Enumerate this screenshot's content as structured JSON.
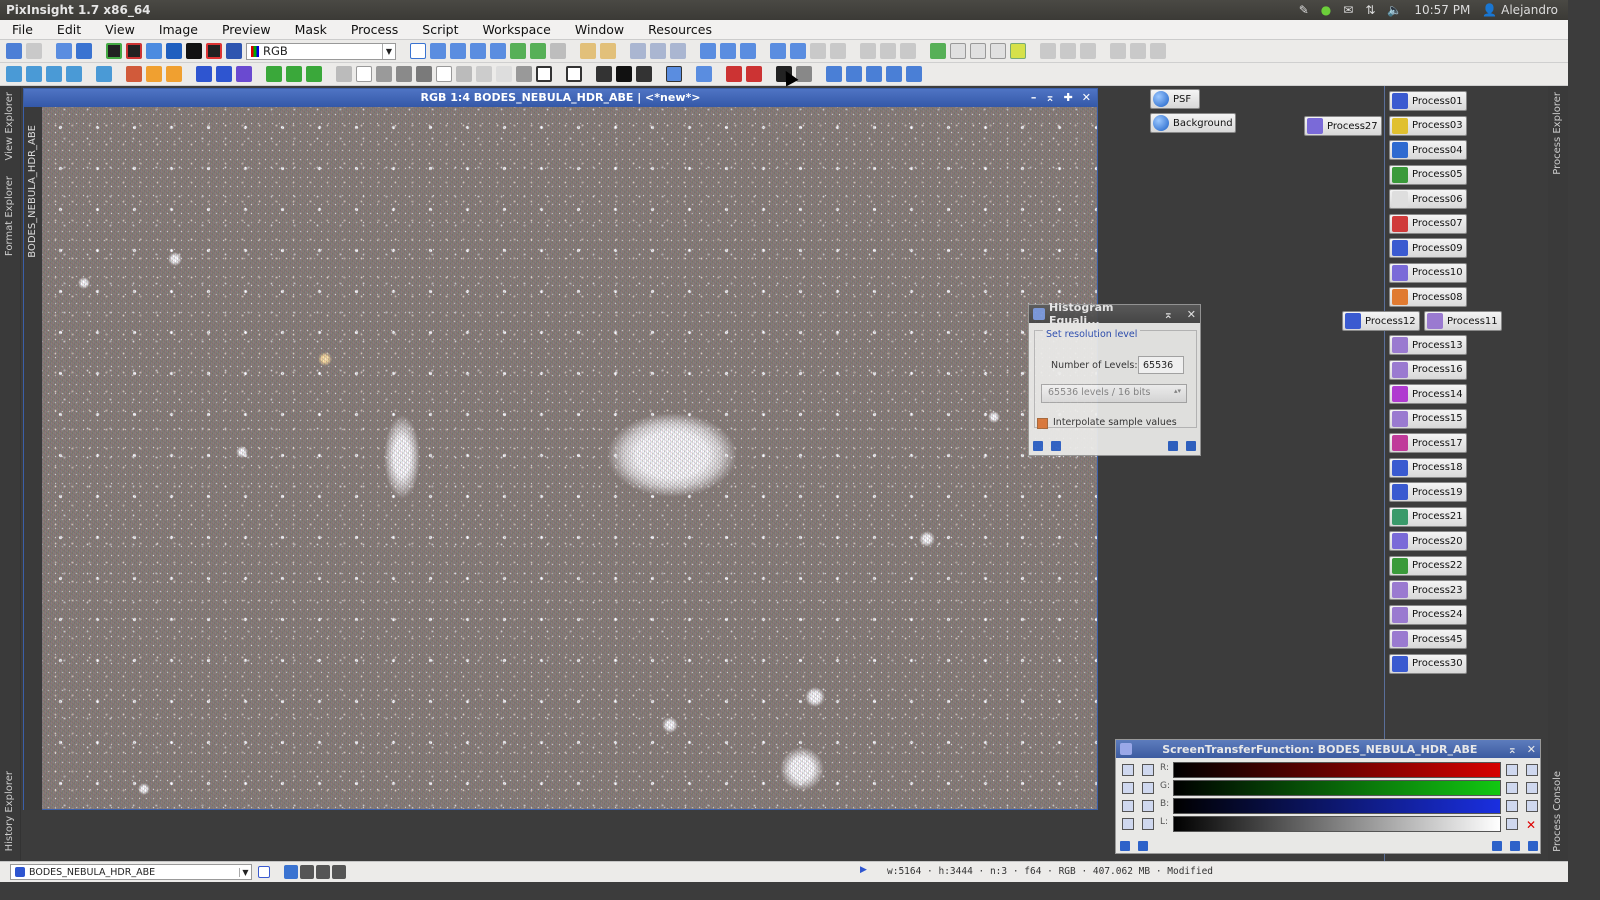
{
  "top_bar": {
    "title": "PixInsight 1.7 x86_64",
    "clock": "10:57 PM",
    "user": "Alejandro"
  },
  "menu": [
    "File",
    "Edit",
    "View",
    "Image",
    "Preview",
    "Mask",
    "Process",
    "Script",
    "Workspace",
    "Window",
    "Resources"
  ],
  "toolbar": {
    "color_space_value": "RGB"
  },
  "side_tabs": {
    "left_top": "View Explorer",
    "left_mid": "Format Explorer",
    "left_bottom": "History Explorer",
    "right_top": "Process Explorer",
    "right_bottom": "Process Console"
  },
  "image_window": {
    "title": "RGB 1:4 BODES_NEBULA_HDR_ABE | <*new*>",
    "vertical_id": "BODES_NEBULA_HDR_ABE"
  },
  "shortcuts": {
    "psf": "PSF",
    "background": "Background",
    "process27": "Process27",
    "process12": "Process12",
    "process11": "Process11",
    "list": [
      "Process01",
      "Process03",
      "Process04",
      "Process05",
      "Process06",
      "Process07",
      "Process09",
      "Process10",
      "Process08",
      "Process13",
      "Process16",
      "Process14",
      "Process15",
      "Process17",
      "Process18",
      "Process19",
      "Process21",
      "Process20",
      "Process22",
      "Process23",
      "Process24",
      "Process45",
      "Process30"
    ]
  },
  "histogram_dialog": {
    "title": "Histogram Equali...",
    "group_label": "Set resolution level",
    "levels_label": "Number of Levels:",
    "levels_value": "65536",
    "combo_value": "65536 levels / 16 bits",
    "interpolate_label": "Interpolate sample values",
    "interpolate_checked": true
  },
  "stf_dialog": {
    "title": "ScreenTransferFunction: BODES_NEBULA_HDR_ABE",
    "channels": [
      "R:",
      "G:",
      "B:",
      "L:"
    ]
  },
  "status": {
    "view_name": "BODES_NEBULA_HDR_ABE",
    "info": "w:5164 · h:3444 · n:3 · f64 · RGB · 407.062 MB · Modified"
  },
  "colors": {
    "title_blue": "#3458a8",
    "accent_orange": "#e07a3a"
  }
}
